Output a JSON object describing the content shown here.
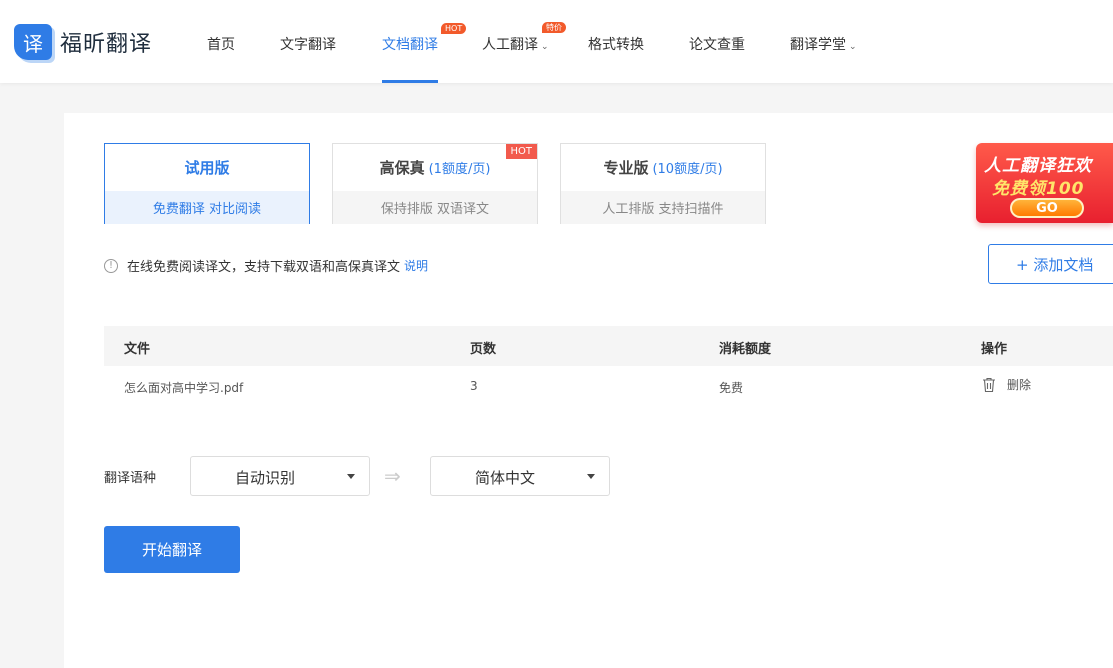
{
  "brand": {
    "logo_glyph": "译",
    "name": "福昕翻译",
    "accent": "#2f7ce6"
  },
  "nav": {
    "items": [
      {
        "label": "首页"
      },
      {
        "label": "文字翻译"
      },
      {
        "label": "文档翻译",
        "badge": "HOT",
        "active": true
      },
      {
        "label": "人工翻译",
        "badge": "特价",
        "dropdown": true
      },
      {
        "label": "格式转换"
      },
      {
        "label": "论文查重"
      },
      {
        "label": "翻译学堂",
        "dropdown": true
      }
    ]
  },
  "plans": [
    {
      "title": "试用版",
      "sub": "",
      "desc": "免费翻译  对比阅读",
      "selected": true
    },
    {
      "title": "高保真",
      "sub": "(1额度/页)",
      "desc": "保持排版  双语译文",
      "tag": "HOT"
    },
    {
      "title": "专业版",
      "sub": "(10额度/页)",
      "desc": "人工排版  支持扫描件"
    }
  ],
  "promo": {
    "line1": "人工翻译狂欢",
    "line2": "免费领100",
    "go": "GO"
  },
  "info": {
    "icon": "info-icon",
    "text": "在线免费阅读译文，支持下载双语和高保真译文",
    "link": "说明"
  },
  "add_doc": {
    "label": "+ 添加文档"
  },
  "table": {
    "headers": [
      "文件",
      "页数",
      "消耗额度",
      "操作"
    ],
    "rows": [
      {
        "file": "怎么面对高中学习.pdf",
        "pages": "3",
        "cost": "免费",
        "action": "删除"
      }
    ]
  },
  "language": {
    "label": "翻译语种",
    "source": "自动识别",
    "arrow": "⇒",
    "target": "简体中文"
  },
  "start_button": {
    "label": "开始翻译"
  }
}
